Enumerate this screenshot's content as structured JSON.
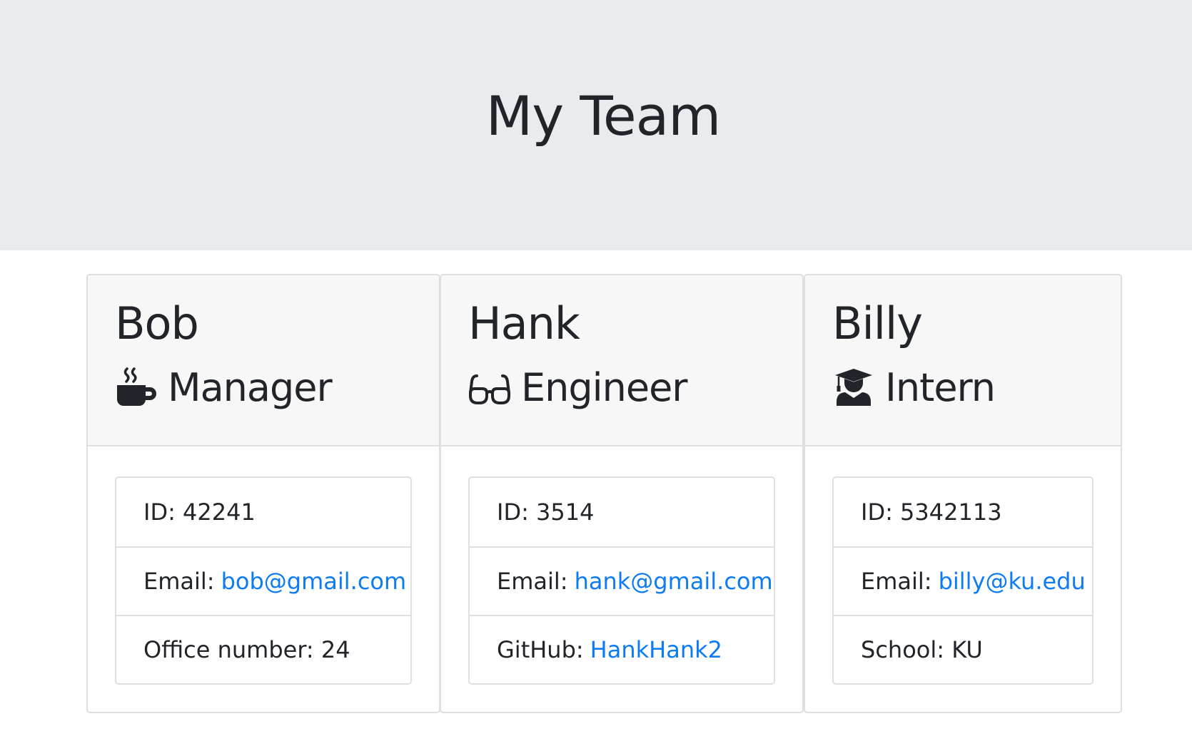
{
  "header": {
    "title": "My Team"
  },
  "colors": {
    "jumbotron_bg": "#e9ecef",
    "card_header_bg": "#f7f7f7",
    "link": "#0d7bf2",
    "text": "#212529",
    "border": "#dfdfdf"
  },
  "employees": [
    {
      "name": "Bob",
      "role": "Manager",
      "role_icon": "mug-hot-icon",
      "id_label": "ID:",
      "id": "42241",
      "email_label": "Email:",
      "email": "bob@gmail.com",
      "extra_label": "Office number:",
      "extra_value": "24"
    },
    {
      "name": "Hank",
      "role": "Engineer",
      "role_icon": "glasses-icon",
      "id_label": "ID:",
      "id": "3514",
      "email_label": "Email:",
      "email": "hank@gmail.com",
      "extra_label": "GitHub:",
      "extra_value": "HankHank2"
    },
    {
      "name": "Billy",
      "role": "Intern",
      "role_icon": "user-graduate-icon",
      "id_label": "ID:",
      "id": "5342113",
      "email_label": "Email:",
      "email": "billy@ku.edu",
      "extra_label": "School:",
      "extra_value": "KU"
    }
  ]
}
